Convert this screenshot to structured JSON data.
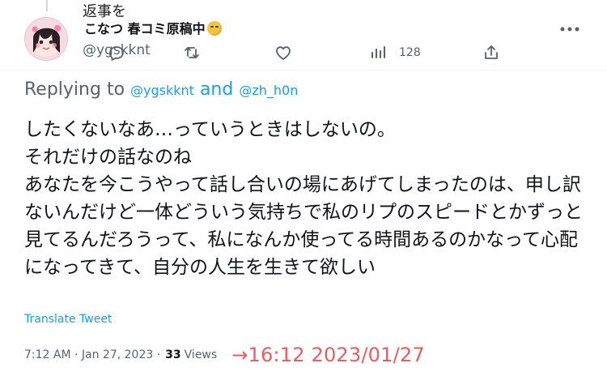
{
  "header": {
    "handwritten_note": "返事を",
    "display_name": "こなつ 春コミ原稿中",
    "handle": "@ygskknt"
  },
  "actions": {
    "reply_icon": "reply-icon",
    "retweet_icon": "retweet-icon",
    "like_icon": "heart-icon",
    "views_icon": "views-icon",
    "views_count": "128",
    "share_icon": "share-icon",
    "more_icon": "more-icon"
  },
  "reply_context": {
    "prefix": "Replying to",
    "mention_1": "@ygskknt",
    "joiner": "and",
    "mention_2": "@zh_h0n"
  },
  "tweet": {
    "text": "したくないなあ…っていうときはしないの。\nそれだけの話なのね\nあなたを今こうやって話し合いの場にあげてしまったのは、申し訳ないんだけど一体どういう気持ちで私のリプのスピードとかずっと見てるんだろうって、私になんか使ってる時間あるのかなって心配になってきて、自分の人生を生きて欲しい",
    "translate_link": "Translate Tweet"
  },
  "meta": {
    "timestamp": "7:12 AM · Jan 27, 2023 ·",
    "views_count": "33",
    "views_label": "Views",
    "annotation": "→16:12  2023/01/27"
  },
  "colors": {
    "accent": "#1d9bf0",
    "secondary_text": "#536471",
    "annotation": "#e85c63"
  }
}
